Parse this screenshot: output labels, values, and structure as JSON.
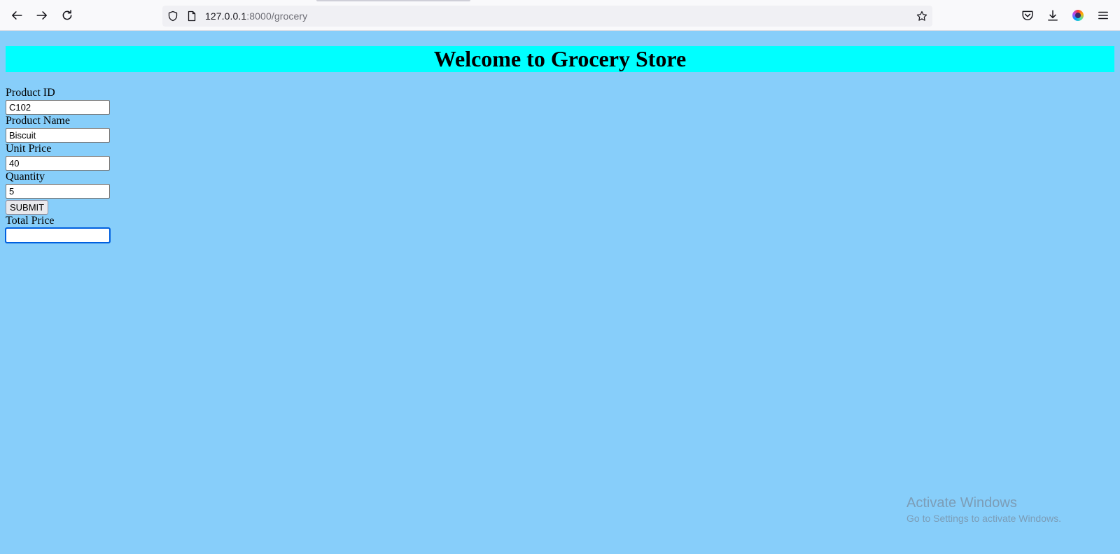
{
  "browser": {
    "url_host": "127.0.0.1",
    "url_path": ":8000/grocery",
    "icons": [
      "back-icon",
      "forward-icon",
      "reload-icon",
      "shield-icon",
      "page-icon",
      "bookmark-star-icon",
      "pocket-icon",
      "download-icon",
      "extension-icon",
      "menu-icon"
    ]
  },
  "page": {
    "title": "Welcome to Grocery Store",
    "banner_color": "#00ffff",
    "background_color": "#87cefa"
  },
  "form": {
    "product_id": {
      "label": "Product ID",
      "value": "C102"
    },
    "product_name": {
      "label": "Product Name",
      "value": "Biscuit"
    },
    "unit_price": {
      "label": "Unit Price",
      "value": "40"
    },
    "quantity": {
      "label": "Quantity",
      "value": "5"
    },
    "submit_label": "SUBMIT",
    "total_price": {
      "label": "Total Price",
      "value": ""
    }
  },
  "watermark": {
    "title": "Activate Windows",
    "subtitle": "Go to Settings to activate Windows."
  }
}
